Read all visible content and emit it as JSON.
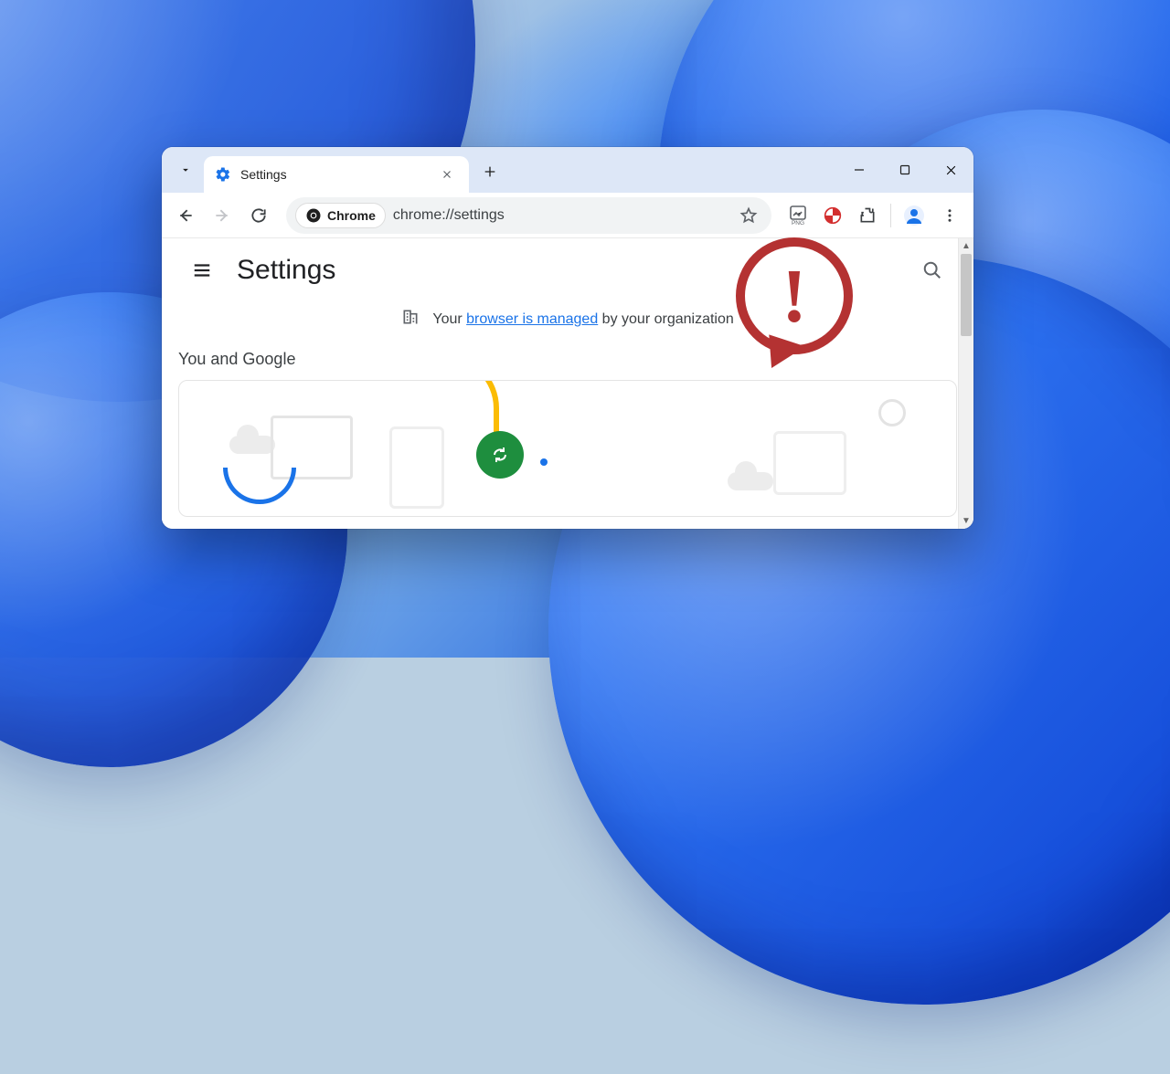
{
  "tab": {
    "title": "Settings"
  },
  "omnibox": {
    "chip_label": "Chrome",
    "url": "chrome://settings"
  },
  "page": {
    "title": "Settings",
    "managed_prefix": "Your ",
    "managed_link": "browser is managed",
    "managed_suffix": " by your organization",
    "section_you_and_google": "You and Google"
  },
  "callout": {
    "glyph": "!"
  }
}
